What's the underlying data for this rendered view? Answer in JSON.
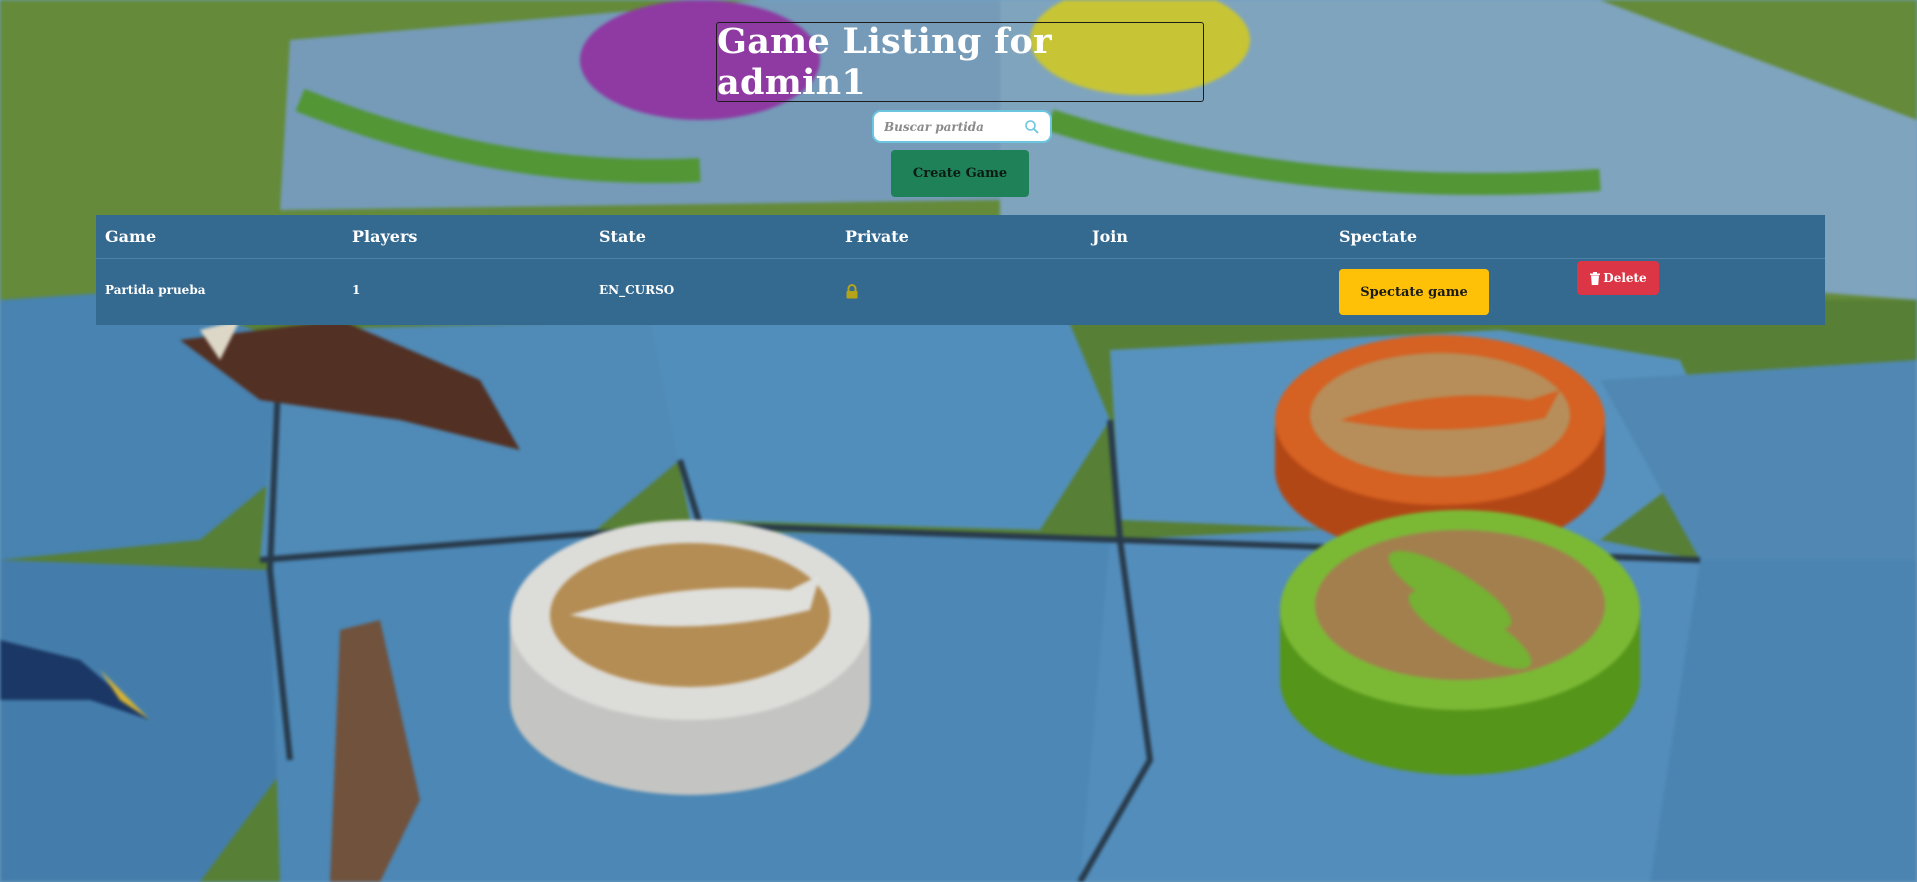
{
  "page": {
    "title": "Game Listing for admin1"
  },
  "search": {
    "placeholder": "Buscar partida",
    "icon": "search-icon"
  },
  "actions": {
    "create_label": "Create Game"
  },
  "table": {
    "headers": [
      "Game",
      "Players",
      "State",
      "Private",
      "Join",
      "Spectate"
    ],
    "rows": [
      {
        "game": "Partida prueba",
        "players": "1",
        "state": "EN_CURSO",
        "private_icon": "lock-icon",
        "join": "",
        "spectate_label": "Spectate game",
        "delete_label": "Delete",
        "delete_icon": "trash-icon"
      }
    ]
  },
  "colors": {
    "table_bg": "#356a90",
    "create_button": "#1e8158",
    "spectate_button": "#ffc107",
    "delete_button": "#dc3545",
    "lock_icon": "#b5a31a"
  }
}
